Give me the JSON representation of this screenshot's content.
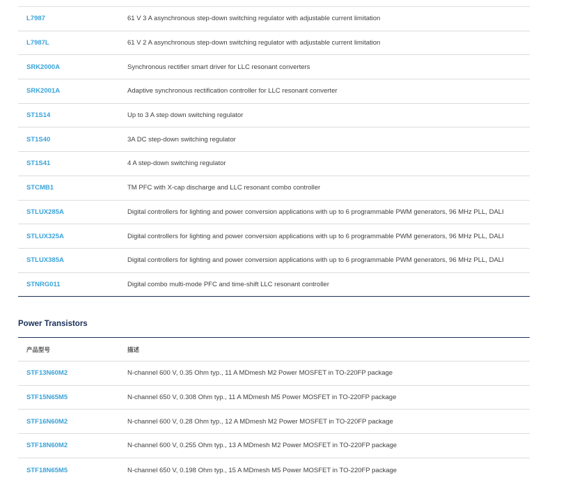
{
  "regulators": {
    "rows": [
      {
        "part": "L7987",
        "desc": "61 V 3 A asynchronous step-down switching regulator with adjustable current limitation"
      },
      {
        "part": "L7987L",
        "desc": "61 V 2 A asynchronous step-down switching regulator with adjustable current limitation"
      },
      {
        "part": "SRK2000A",
        "desc": "Synchronous rectifier smart driver for LLC resonant converters"
      },
      {
        "part": "SRK2001A",
        "desc": "Adaptive synchronous rectification controller for LLC resonant converter"
      },
      {
        "part": "ST1S14",
        "desc": "Up to 3 A step down switching regulator"
      },
      {
        "part": "ST1S40",
        "desc": "3A DC step-down switching regulator"
      },
      {
        "part": "ST1S41",
        "desc": "4 A step-down switching regulator"
      },
      {
        "part": "STCMB1",
        "desc": "TM PFC with X-cap discharge and LLC resonant combo controller"
      },
      {
        "part": "STLUX285A",
        "desc": "Digital controllers for lighting and power conversion applications with up to 6 programmable PWM generators, 96 MHz PLL, DALI"
      },
      {
        "part": "STLUX325A",
        "desc": "Digital controllers for lighting and power conversion applications with up to 6 programmable PWM generators, 96 MHz PLL, DALI"
      },
      {
        "part": "STLUX385A",
        "desc": "Digital controllers for lighting and power conversion applications with up to 6 programmable PWM generators, 96 MHz PLL, DALI"
      },
      {
        "part": "STNRG011",
        "desc": "Digital combo multi-mode PFC and time-shift LLC resonant controller"
      }
    ]
  },
  "power_transistors": {
    "title": "Power Transistors",
    "header": {
      "part": "产品型号",
      "desc": "描述"
    },
    "rows": [
      {
        "part": "STF13N60M2",
        "desc": "N-channel 600 V, 0.35 Ohm typ., 11 A MDmesh M2 Power MOSFET in TO-220FP package"
      },
      {
        "part": "STF15N65M5",
        "desc": "N-channel 650 V, 0.308 Ohm typ., 11 A MDmesh M5 Power MOSFET in TO-220FP package"
      },
      {
        "part": "STF16N60M2",
        "desc": "N-channel 600 V, 0.28 Ohm typ., 12 A MDmesh M2 Power MOSFET in TO-220FP package"
      },
      {
        "part": "STF18N60M2",
        "desc": "N-channel 600 V, 0.255 Ohm typ., 13 A MDmesh M2 Power MOSFET in TO-220FP package"
      },
      {
        "part": "STF18N65M5",
        "desc": "N-channel 650 V, 0.198 Ohm typ., 15 A MDmesh M5 Power MOSFET in TO-220FP package"
      }
    ]
  },
  "colors": {
    "link": "#3aa3d9",
    "heading": "#1b2f5a",
    "divider": "#dcdcdc"
  }
}
